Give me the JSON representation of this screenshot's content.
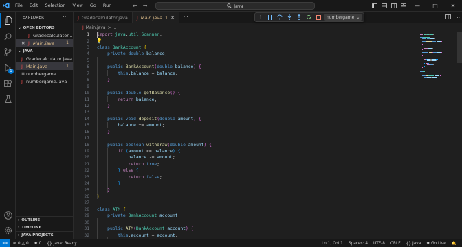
{
  "titlebar": {
    "menu": [
      "File",
      "Edit",
      "Selection",
      "View",
      "Go",
      "Run",
      "···"
    ],
    "search_text": "java",
    "nav_back": "←",
    "nav_forward": "→"
  },
  "sidebar": {
    "title": "EXPLORER",
    "more": "···",
    "open_editors_label": "OPEN EDITORS",
    "open_editors": [
      {
        "name": "Gradecalculator...",
        "italic": false,
        "modified": false
      },
      {
        "name": "Main.java",
        "italic": true,
        "modified": true,
        "badge": "1"
      }
    ],
    "folder_label": "JAVA",
    "files": [
      {
        "name": "Gradecalculator.java",
        "type": "java",
        "badge": ""
      },
      {
        "name": "Main.java",
        "type": "java",
        "badge": "1"
      },
      {
        "name": "numbergame",
        "type": "class",
        "badge": ""
      },
      {
        "name": "numbergame.java",
        "type": "java",
        "badge": ""
      }
    ],
    "bottom_sections": [
      "OUTLINE",
      "TIMELINE",
      "JAVA PROJECTS"
    ]
  },
  "activity_badge": "1",
  "tabs": [
    {
      "label": "Gradecalculator.java",
      "active": false
    },
    {
      "label": "Main.java",
      "badge": "1",
      "active": true
    }
  ],
  "tab_more": "···",
  "debug": {
    "config": "numbergame"
  },
  "breadcrumb": {
    "file": "Main.java",
    "rest": ">  ..."
  },
  "editor": {
    "lines": [
      {
        "n": "1",
        "code": [
          [
            "k-ctrl",
            "import"
          ],
          [
            "k-txt",
            " "
          ],
          [
            "k-type",
            "java"
          ],
          [
            "k-txt",
            "."
          ],
          [
            "k-type",
            "util"
          ],
          [
            "k-txt",
            "."
          ],
          [
            "k-type",
            "Scanner"
          ],
          [
            "k-txt",
            ";"
          ]
        ]
      },
      {
        "n": "2",
        "code": []
      },
      {
        "n": "3",
        "code": [
          [
            "k-kw",
            "class"
          ],
          [
            "k-txt",
            " "
          ],
          [
            "k-type",
            "BankAccount"
          ],
          [
            "k-txt",
            " "
          ],
          [
            "k-pun",
            "{"
          ]
        ]
      },
      {
        "n": "4",
        "code": [
          [
            "k-txt",
            "    "
          ],
          [
            "k-kw",
            "private"
          ],
          [
            "k-txt",
            " "
          ],
          [
            "k-kw",
            "double"
          ],
          [
            "k-txt",
            " "
          ],
          [
            "k-var",
            "balance"
          ],
          [
            "k-txt",
            ";"
          ]
        ]
      },
      {
        "n": "5",
        "code": []
      },
      {
        "n": "6",
        "code": [
          [
            "k-txt",
            "    "
          ],
          [
            "k-kw",
            "public"
          ],
          [
            "k-txt",
            " "
          ],
          [
            "k-fn",
            "BankAccount"
          ],
          [
            "k-pun2",
            "("
          ],
          [
            "k-kw",
            "double"
          ],
          [
            "k-txt",
            " "
          ],
          [
            "k-var",
            "balance"
          ],
          [
            "k-pun2",
            ")"
          ],
          [
            "k-txt",
            " "
          ],
          [
            "k-pun2",
            "{"
          ]
        ]
      },
      {
        "n": "7",
        "code": [
          [
            "k-txt",
            "        "
          ],
          [
            "k-kw",
            "this"
          ],
          [
            "k-txt",
            "."
          ],
          [
            "k-var",
            "balance"
          ],
          [
            "k-txt",
            " = "
          ],
          [
            "k-var",
            "balance"
          ],
          [
            "k-txt",
            ";"
          ]
        ]
      },
      {
        "n": "8",
        "code": [
          [
            "k-txt",
            "    "
          ],
          [
            "k-pun2",
            "}"
          ]
        ]
      },
      {
        "n": "9",
        "code": []
      },
      {
        "n": "10",
        "code": [
          [
            "k-txt",
            "    "
          ],
          [
            "k-kw",
            "public"
          ],
          [
            "k-txt",
            " "
          ],
          [
            "k-kw",
            "double"
          ],
          [
            "k-txt",
            " "
          ],
          [
            "k-fn",
            "getBalance"
          ],
          [
            "k-pun2",
            "()"
          ],
          [
            "k-txt",
            " "
          ],
          [
            "k-pun2",
            "{"
          ]
        ]
      },
      {
        "n": "11",
        "code": [
          [
            "k-txt",
            "        "
          ],
          [
            "k-ctrl",
            "return"
          ],
          [
            "k-txt",
            " "
          ],
          [
            "k-var",
            "balance"
          ],
          [
            "k-txt",
            ";"
          ]
        ]
      },
      {
        "n": "12",
        "code": [
          [
            "k-txt",
            "    "
          ],
          [
            "k-pun2",
            "}"
          ]
        ]
      },
      {
        "n": "13",
        "code": []
      },
      {
        "n": "14",
        "code": [
          [
            "k-txt",
            "    "
          ],
          [
            "k-kw",
            "public"
          ],
          [
            "k-txt",
            " "
          ],
          [
            "k-kw",
            "void"
          ],
          [
            "k-txt",
            " "
          ],
          [
            "k-fn",
            "deposit"
          ],
          [
            "k-pun2",
            "("
          ],
          [
            "k-kw",
            "double"
          ],
          [
            "k-txt",
            " "
          ],
          [
            "k-var",
            "amount"
          ],
          [
            "k-pun2",
            ")"
          ],
          [
            "k-txt",
            " "
          ],
          [
            "k-pun2",
            "{"
          ]
        ]
      },
      {
        "n": "15",
        "code": [
          [
            "k-txt",
            "        "
          ],
          [
            "k-var",
            "balance"
          ],
          [
            "k-txt",
            " += "
          ],
          [
            "k-var",
            "amount"
          ],
          [
            "k-txt",
            ";"
          ]
        ]
      },
      {
        "n": "16",
        "code": [
          [
            "k-txt",
            "    "
          ],
          [
            "k-pun2",
            "}"
          ]
        ]
      },
      {
        "n": "17",
        "code": []
      },
      {
        "n": "18",
        "code": [
          [
            "k-txt",
            "    "
          ],
          [
            "k-kw",
            "public"
          ],
          [
            "k-txt",
            " "
          ],
          [
            "k-kw",
            "boolean"
          ],
          [
            "k-txt",
            " "
          ],
          [
            "k-fn",
            "withdraw"
          ],
          [
            "k-pun2",
            "("
          ],
          [
            "k-kw",
            "double"
          ],
          [
            "k-txt",
            " "
          ],
          [
            "k-var",
            "amount"
          ],
          [
            "k-pun2",
            ")"
          ],
          [
            "k-txt",
            " "
          ],
          [
            "k-pun2",
            "{"
          ]
        ]
      },
      {
        "n": "19",
        "code": [
          [
            "k-txt",
            "        "
          ],
          [
            "k-ctrl",
            "if"
          ],
          [
            "k-txt",
            " "
          ],
          [
            "k-pun3",
            "("
          ],
          [
            "k-var",
            "amount"
          ],
          [
            "k-txt",
            " <= "
          ],
          [
            "k-var",
            "balance"
          ],
          [
            "k-pun3",
            ")"
          ],
          [
            "k-txt",
            " "
          ],
          [
            "k-pun3",
            "{"
          ]
        ]
      },
      {
        "n": "20",
        "code": [
          [
            "k-txt",
            "            "
          ],
          [
            "k-var",
            "balance"
          ],
          [
            "k-txt",
            " -= "
          ],
          [
            "k-var",
            "amount"
          ],
          [
            "k-txt",
            ";"
          ]
        ]
      },
      {
        "n": "21",
        "code": [
          [
            "k-txt",
            "            "
          ],
          [
            "k-ctrl",
            "return"
          ],
          [
            "k-txt",
            " "
          ],
          [
            "k-kw",
            "true"
          ],
          [
            "k-txt",
            ";"
          ]
        ]
      },
      {
        "n": "22",
        "code": [
          [
            "k-txt",
            "        "
          ],
          [
            "k-pun3",
            "}"
          ],
          [
            "k-txt",
            " "
          ],
          [
            "k-ctrl",
            "else"
          ],
          [
            "k-txt",
            " "
          ],
          [
            "k-pun3",
            "{"
          ]
        ]
      },
      {
        "n": "23",
        "code": [
          [
            "k-txt",
            "            "
          ],
          [
            "k-ctrl",
            "return"
          ],
          [
            "k-txt",
            " "
          ],
          [
            "k-kw",
            "false"
          ],
          [
            "k-txt",
            ";"
          ]
        ]
      },
      {
        "n": "24",
        "code": [
          [
            "k-txt",
            "        "
          ],
          [
            "k-pun3",
            "}"
          ]
        ]
      },
      {
        "n": "25",
        "code": [
          [
            "k-txt",
            "    "
          ],
          [
            "k-pun2",
            "}"
          ]
        ]
      },
      {
        "n": "26",
        "code": [
          [
            "k-pun",
            "}"
          ]
        ]
      },
      {
        "n": "27",
        "code": []
      },
      {
        "n": "28",
        "code": [
          [
            "k-kw",
            "class"
          ],
          [
            "k-txt",
            " "
          ],
          [
            "k-type",
            "ATM"
          ],
          [
            "k-txt",
            " "
          ],
          [
            "k-pun",
            "{"
          ]
        ]
      },
      {
        "n": "29",
        "code": [
          [
            "k-txt",
            "    "
          ],
          [
            "k-kw",
            "private"
          ],
          [
            "k-txt",
            " "
          ],
          [
            "k-type",
            "BankAccount"
          ],
          [
            "k-txt",
            " "
          ],
          [
            "k-var",
            "account"
          ],
          [
            "k-txt",
            ";"
          ]
        ]
      },
      {
        "n": "30",
        "code": []
      },
      {
        "n": "31",
        "code": [
          [
            "k-txt",
            "    "
          ],
          [
            "k-kw",
            "public"
          ],
          [
            "k-txt",
            " "
          ],
          [
            "k-fn",
            "ATM"
          ],
          [
            "k-pun2",
            "("
          ],
          [
            "k-type",
            "BankAccount"
          ],
          [
            "k-txt",
            " "
          ],
          [
            "k-var",
            "account"
          ],
          [
            "k-pun2",
            ")"
          ],
          [
            "k-txt",
            " "
          ],
          [
            "k-pun2",
            "{"
          ]
        ]
      },
      {
        "n": "32",
        "code": [
          [
            "k-txt",
            "        "
          ],
          [
            "k-kw",
            "this"
          ],
          [
            "k-txt",
            "."
          ],
          [
            "k-var",
            "account"
          ],
          [
            "k-txt",
            " = "
          ],
          [
            "k-var",
            "account"
          ],
          [
            "k-txt",
            ";"
          ]
        ]
      }
    ]
  },
  "status": {
    "remote": "><",
    "errors": "0",
    "warnings": "0",
    "sync": "0",
    "java_status": "Java: Ready",
    "position": "Ln 1, Col 1",
    "spaces": "Spaces: 4",
    "encoding": "UTF-8",
    "eol": "CRLF",
    "language": "Java",
    "golive": "Go Live"
  },
  "colors": {
    "accent": "#0078d4",
    "modified": "#e2c08d",
    "java_icon": "#f14c4c"
  }
}
